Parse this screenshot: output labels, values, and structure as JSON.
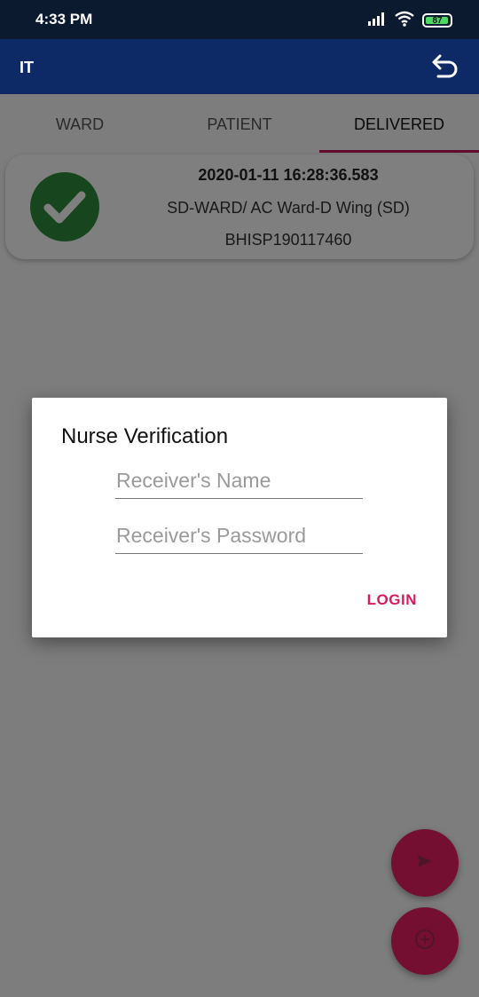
{
  "status_bar": {
    "time": "4:33 PM",
    "battery_level": "87",
    "icons": [
      "signal-icon",
      "wifi-icon",
      "battery-icon"
    ]
  },
  "app_bar": {
    "title": "IT",
    "undo_icon": "undo-icon"
  },
  "tabs": [
    {
      "label": "WARD",
      "selected": false
    },
    {
      "label": "PATIENT",
      "selected": false
    },
    {
      "label": "DELIVERED",
      "selected": true
    }
  ],
  "record": {
    "timestamp": "2020-01-11 16:28:36.583",
    "location": "SD-WARD/ AC Ward-D Wing (SD)",
    "id": "BHISP190117460",
    "status_icon": "check-circle-icon"
  },
  "dialog": {
    "title": "Nurse Verification",
    "name_placeholder": "Receiver's Name",
    "name_value": "",
    "password_placeholder": "Receiver's Password",
    "password_value": "",
    "login_label": "LOGIN"
  },
  "fabs": [
    {
      "icon": "send-icon"
    },
    {
      "icon": "add-circle-icon"
    }
  ],
  "colors": {
    "status_bar": "#0b1a2e",
    "app_bar": "#0d2a66",
    "accent": "#e91e63",
    "tab_indicator": "#c2185b",
    "success": "#2e8b3a",
    "login_text": "#d81b60"
  }
}
